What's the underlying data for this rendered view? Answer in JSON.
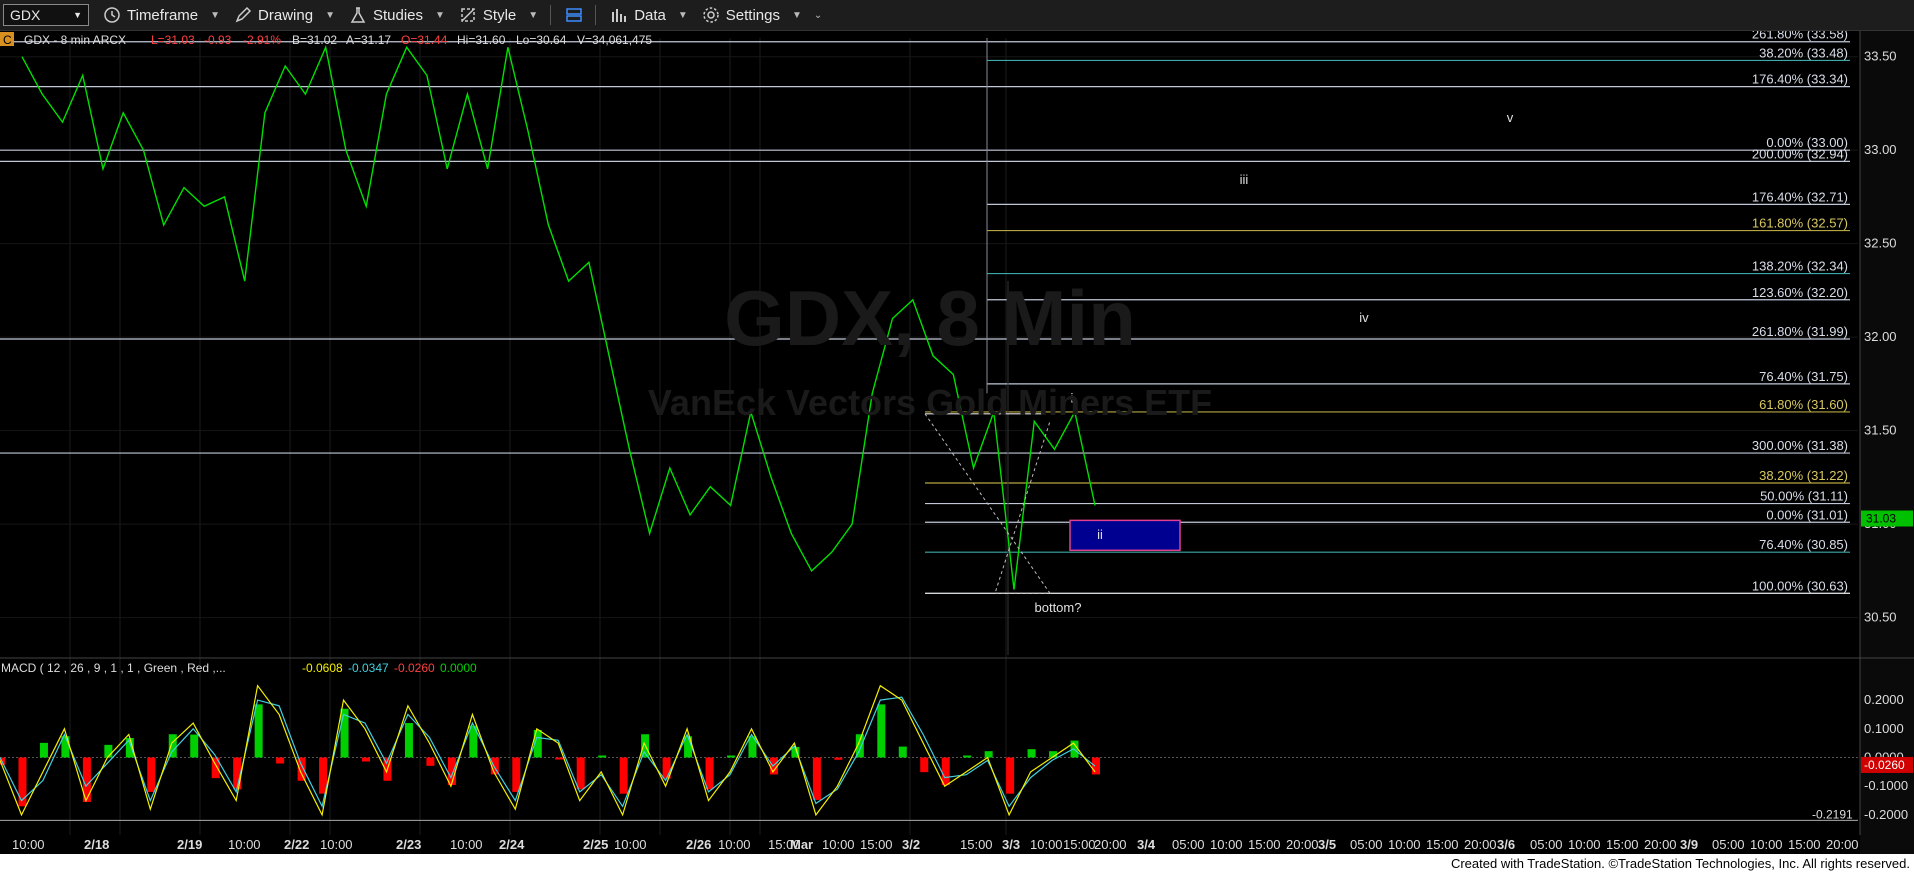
{
  "toolbar": {
    "symbol": "GDX",
    "timeframe": "Timeframe",
    "drawing": "Drawing",
    "studies": "Studies",
    "style": "Style",
    "data": "Data",
    "settings": "Settings"
  },
  "header": {
    "badge": "C",
    "symbol_info": "GDX - 8 min  ARCX",
    "last": "L=31.03",
    "change": "-0.93",
    "change_pct": "-2.91%",
    "bid": "B=31.02",
    "ask": "A=31.17",
    "open": "O=31.44",
    "high": "Hi=31.60",
    "low": "Lo=30.64",
    "volume": "V=34,061,475"
  },
  "watermark": {
    "line1": "GDX, 8 Min",
    "line2": "VanEck Vectors Gold Miners ETF"
  },
  "macd_header": {
    "label": "MACD ( 12 , 26 , 9 , 1 , 1 , Green , Red ,...",
    "v1": "-0.0608",
    "v2": "-0.0347",
    "v3": "-0.0260",
    "v4": "0.0000"
  },
  "footer": "Created with TradeStation. ©TradeStation Technologies, Inc. All rights reserved.",
  "colors": {
    "price": "#00e000",
    "macd": "#f4f000",
    "signal": "#40d0e0",
    "hist_up": "#00d000",
    "hist_down": "#ff0000",
    "fib_gray": "#c0c8d8",
    "fib_gold": "#b5a642",
    "fib_teal": "#3fa8a8"
  },
  "chart_data": {
    "type": "line",
    "title": "GDX - 8 min ARCX",
    "price_axis": {
      "ticks": [
        "33.50",
        "33.00",
        "32.50",
        "32.00",
        "31.50",
        "31.00",
        "30.50"
      ],
      "ylim": [
        30.3,
        33.6
      ]
    },
    "last_price_label": "31.03",
    "time_axis_labels": [
      "10:00",
      "2/18",
      "2/19",
      "10:00",
      "2/22",
      "10:00",
      "2/23",
      "10:00",
      "2/24",
      "2/25",
      "10:00",
      "2/26",
      "10:00",
      "15:00",
      "Mar",
      "10:00",
      "15:00",
      "3/2",
      "15:00",
      "3/3",
      "10:00",
      "15:00",
      "20:00",
      "3/4",
      "05:00",
      "10:00",
      "15:00",
      "20:00",
      "3/5",
      "05:00",
      "10:00",
      "15:00",
      "20:00",
      "3/6",
      "05:00",
      "10:00",
      "15:00",
      "20:00",
      "3/9",
      "05:00",
      "10:00",
      "15:00",
      "20:00"
    ],
    "series": [
      {
        "name": "GDX",
        "values": [
          33.5,
          33.3,
          33.15,
          33.4,
          32.9,
          33.2,
          33.0,
          32.6,
          32.8,
          32.7,
          32.75,
          32.3,
          33.2,
          33.45,
          33.3,
          33.55,
          33.0,
          32.7,
          33.3,
          33.55,
          33.4,
          32.9,
          33.3,
          32.9,
          33.55,
          33.1,
          32.6,
          32.3,
          32.4,
          31.9,
          31.4,
          30.95,
          31.3,
          31.05,
          31.2,
          31.1,
          31.6,
          31.25,
          30.95,
          30.75,
          30.85,
          31.0,
          31.7,
          32.1,
          32.2,
          31.9,
          31.8,
          31.3,
          31.6,
          30.65,
          31.55,
          31.4,
          31.6,
          31.1
        ]
      },
      {
        "name": "MACD",
        "values": [
          -0.01,
          -0.2,
          -0.05,
          0.1,
          -0.15,
          0.0,
          0.08,
          -0.18,
          0.05,
          0.12,
          -0.02,
          -0.15,
          0.25,
          0.15,
          -0.05,
          -0.2,
          0.2,
          0.1,
          -0.05,
          0.18,
          0.05,
          -0.1,
          0.15,
          -0.05,
          -0.18,
          0.1,
          0.05,
          -0.15,
          -0.05,
          -0.2,
          0.05,
          -0.1,
          0.1,
          -0.15,
          -0.05,
          0.1,
          -0.05,
          0.05,
          -0.2,
          -0.1,
          0.05,
          0.25,
          0.2,
          0.05,
          -0.1,
          -0.05,
          0.0,
          -0.2,
          -0.05,
          0.0,
          0.05,
          -0.05
        ]
      },
      {
        "name": "Signal",
        "values": [
          0.0,
          -0.15,
          -0.08,
          0.08,
          -0.1,
          -0.02,
          0.06,
          -0.15,
          0.02,
          0.1,
          0.01,
          -0.12,
          0.2,
          0.18,
          -0.02,
          -0.17,
          0.15,
          0.12,
          -0.02,
          0.15,
          0.07,
          -0.07,
          0.12,
          -0.03,
          -0.15,
          0.07,
          0.06,
          -0.12,
          -0.06,
          -0.17,
          0.02,
          -0.08,
          0.08,
          -0.12,
          -0.06,
          0.08,
          -0.03,
          0.04,
          -0.16,
          -0.11,
          0.02,
          0.2,
          0.21,
          0.08,
          -0.07,
          -0.06,
          -0.01,
          -0.17,
          -0.07,
          -0.01,
          0.03,
          -0.03
        ]
      }
    ],
    "fib_levels": [
      {
        "label": "261.80% (33.58)",
        "price": 33.58,
        "color": "gray"
      },
      {
        "label": "38.20% (33.48)",
        "price": 33.48,
        "color": "teal"
      },
      {
        "label": "176.40% (33.34)",
        "price": 33.34,
        "color": "gray"
      },
      {
        "label": "0.00% (33.00)",
        "price": 33.0,
        "color": "gray"
      },
      {
        "label": "200.00% (32.94)",
        "price": 32.94,
        "color": "gray"
      },
      {
        "label": "176.40% (32.71)",
        "price": 32.71,
        "color": "gray"
      },
      {
        "label": "161.80% (32.57)",
        "price": 32.57,
        "color": "gold"
      },
      {
        "label": "138.20% (32.34)",
        "price": 32.34,
        "color": "teal"
      },
      {
        "label": "123.60% (32.20)",
        "price": 32.2,
        "color": "gray"
      },
      {
        "label": "261.80% (31.99)",
        "price": 31.99,
        "color": "gray"
      },
      {
        "label": "76.40% (31.75)",
        "price": 31.75,
        "color": "gray"
      },
      {
        "label": "61.80% (31.60)",
        "price": 31.6,
        "color": "gold"
      },
      {
        "label": "300.00% (31.38)",
        "price": 31.38,
        "color": "gray"
      },
      {
        "label": "38.20% (31.22)",
        "price": 31.22,
        "color": "gold"
      },
      {
        "label": "50.00% (31.11)",
        "price": 31.11,
        "color": "gray"
      },
      {
        "label": "0.00% (31.01)",
        "price": 31.01,
        "color": "gray"
      },
      {
        "label": "76.40% (30.85)",
        "price": 30.85,
        "color": "teal"
      },
      {
        "label": "100.00% (30.63)",
        "price": 30.63,
        "color": "gray"
      }
    ],
    "wave_labels": [
      "v",
      "iii",
      "iv",
      "i",
      "ii",
      "bottom?"
    ],
    "macd_axis": {
      "ticks": [
        "0.2000",
        "0.1000",
        "0.0000",
        "-0.1000",
        "-0.2000"
      ],
      "ylim": [
        -0.27,
        0.27
      ],
      "labels": [
        "-0.0260",
        "-0.2191"
      ]
    }
  }
}
